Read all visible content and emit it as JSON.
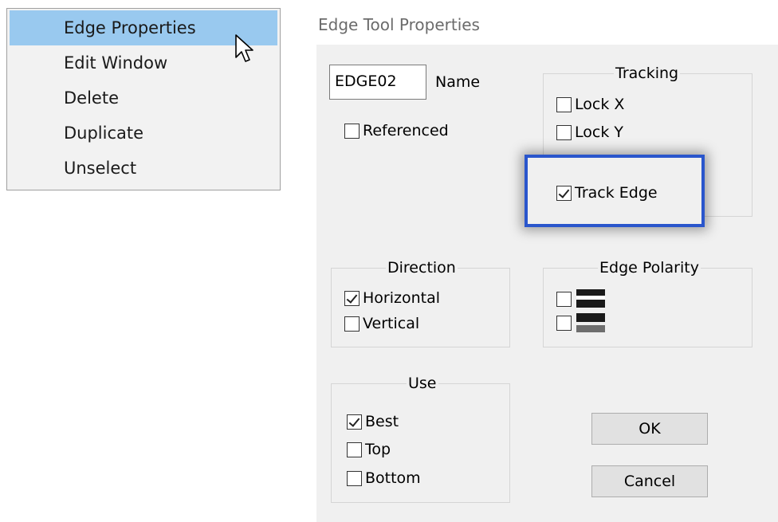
{
  "context_menu": {
    "items": [
      {
        "label": "Edge Properties",
        "highlighted": true
      },
      {
        "label": "Edit Window"
      },
      {
        "label": "Delete"
      },
      {
        "label": "Duplicate"
      },
      {
        "label": "Unselect"
      }
    ]
  },
  "dialog": {
    "title": "Edge Tool Properties",
    "name_field": {
      "value": "EDGE02",
      "label": "Name"
    },
    "referenced": {
      "label": "Referenced",
      "checked": false
    },
    "tracking": {
      "title": "Tracking",
      "lock_x": {
        "label": "Lock X",
        "checked": false
      },
      "lock_y": {
        "label": "Lock Y",
        "checked": false
      },
      "track_edge": {
        "label": "Track Edge",
        "checked": true
      }
    },
    "direction": {
      "title": "Direction",
      "horizontal": {
        "label": "Horizontal",
        "checked": true
      },
      "vertical": {
        "label": "Vertical",
        "checked": false
      }
    },
    "edge_polarity": {
      "title": "Edge Polarity",
      "options": [
        {
          "checked": false,
          "icon": "white-to-black-polarity-icon"
        },
        {
          "checked": false,
          "icon": "black-to-white-polarity-icon"
        }
      ]
    },
    "use": {
      "title": "Use",
      "best": {
        "label": "Best",
        "checked": true
      },
      "top": {
        "label": "Top",
        "checked": false
      },
      "bottom": {
        "label": "Bottom",
        "checked": false
      }
    },
    "ok_label": "OK",
    "cancel_label": "Cancel"
  },
  "colors": {
    "menu_highlight": "#99c9ef",
    "emphasis_border": "#2a56cc",
    "dialog_background": "#f0f0f0"
  }
}
